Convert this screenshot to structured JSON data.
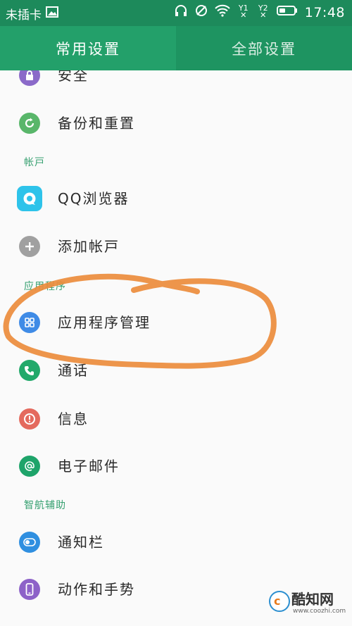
{
  "status_bar": {
    "carrier": "未插卡",
    "sim1": "Y1",
    "sim2": "Y2",
    "sim_x": "✕",
    "time": "17:48"
  },
  "tabs": [
    {
      "label": "常用设置",
      "active": true
    },
    {
      "label": "全部设置",
      "active": false
    }
  ],
  "sections": {
    "accounts": "帐戸",
    "apps": "应用程序",
    "smart": "智航辅助"
  },
  "items": [
    {
      "label": "安全",
      "icon": "lock-icon",
      "color": "#8b6ac9"
    },
    {
      "label": "备份和重置",
      "icon": "refresh-icon",
      "color": "#59b66a"
    },
    {
      "label": "QQ浏览器",
      "icon": "qq-browser-icon",
      "color": "#2ec3ea"
    },
    {
      "label": "添加帐戸",
      "icon": "plus-icon",
      "color": "#a0a0a0"
    },
    {
      "label": "应用程序管理",
      "icon": "grid-icon",
      "color": "#3f8be6"
    },
    {
      "label": "通话",
      "icon": "phone-icon",
      "color": "#22a96a"
    },
    {
      "label": "信息",
      "icon": "alert-icon",
      "color": "#e46a5e"
    },
    {
      "label": "电子邮件",
      "icon": "at-icon",
      "color": "#1ea46a"
    },
    {
      "label": "通知栏",
      "icon": "toggle-icon",
      "color": "#2f8fe0"
    },
    {
      "label": "动作和手势",
      "icon": "phone-device-icon",
      "color": "#8d62c8"
    }
  ],
  "watermark": {
    "logo_letter": "c",
    "title": "酷知网",
    "url": "www.coozhi.com"
  },
  "colors": {
    "status_bar": "#1d8a5b",
    "tab_active": "#23a06a",
    "tab_inactive": "#1e9461",
    "section_text": "#36a070",
    "annotation": "#ec8c3c"
  }
}
